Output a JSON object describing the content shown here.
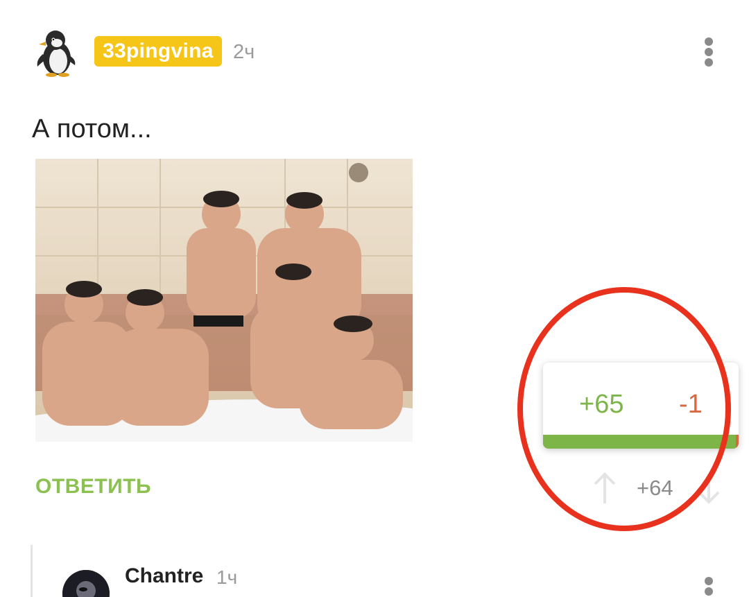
{
  "comment": {
    "avatar_icon": "penguin-icon",
    "username": "33pingvina",
    "time": "2ч",
    "text": "А потом...",
    "image_alt": "group photo",
    "reply_label": "ОТВЕТИТЬ",
    "rating": "+64",
    "votes_popup": {
      "plus": "+65",
      "minus": "-1",
      "plus_fraction": 0.985
    },
    "colors": {
      "username_badge": "#f5c518",
      "reply": "#8cc152",
      "plus": "#7db548",
      "minus": "#d9683f",
      "highlight": "#e8321e"
    }
  },
  "reply_comment": {
    "username": "Chantre",
    "time": "1ч"
  }
}
